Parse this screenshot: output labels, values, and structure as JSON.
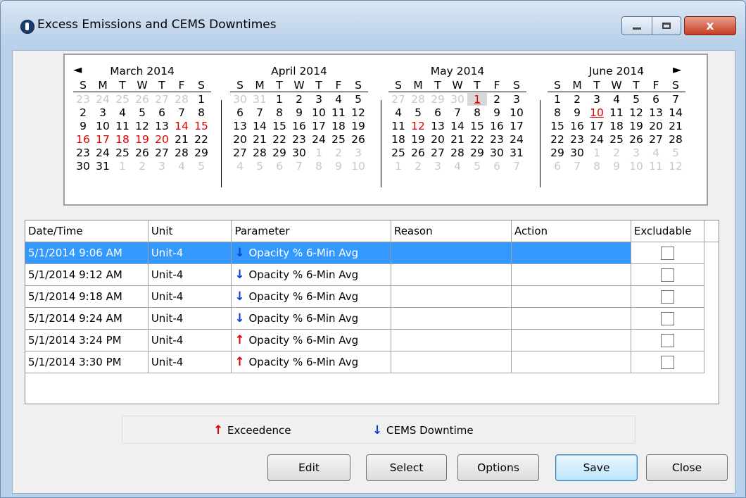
{
  "window": {
    "title": "Excess Emissions and CEMS Downtimes",
    "close_glyph": "x"
  },
  "calendar": {
    "nav_prev": "◄",
    "nav_next": "►",
    "weekday_headers": [
      "S",
      "M",
      "T",
      "W",
      "T",
      "F",
      "S"
    ],
    "months": [
      {
        "title": "March 2014",
        "days": [
          [
            "23",
            "",
            "fill"
          ],
          [
            "24",
            "",
            "fill"
          ],
          [
            "25",
            "",
            "fill"
          ],
          [
            "26",
            "",
            "fill"
          ],
          [
            "27",
            "",
            "fill"
          ],
          [
            "28",
            "",
            "fill"
          ],
          [
            "1",
            "",
            ""
          ],
          [
            "2",
            "",
            ""
          ],
          [
            "3",
            "",
            ""
          ],
          [
            "4",
            "",
            ""
          ],
          [
            "5",
            "",
            ""
          ],
          [
            "6",
            "",
            ""
          ],
          [
            "7",
            "",
            ""
          ],
          [
            "8",
            "",
            ""
          ],
          [
            "9",
            "",
            ""
          ],
          [
            "10",
            "",
            ""
          ],
          [
            "11",
            "",
            ""
          ],
          [
            "12",
            "",
            ""
          ],
          [
            "13",
            "",
            ""
          ],
          [
            "14",
            "",
            "red"
          ],
          [
            "15",
            "",
            "red"
          ],
          [
            "16",
            "",
            "red"
          ],
          [
            "17",
            "",
            "red"
          ],
          [
            "18",
            "",
            "red"
          ],
          [
            "19",
            "",
            "red"
          ],
          [
            "20",
            "",
            "red"
          ],
          [
            "21",
            "",
            ""
          ],
          [
            "22",
            "",
            ""
          ],
          [
            "23",
            "",
            ""
          ],
          [
            "24",
            "",
            ""
          ],
          [
            "25",
            "",
            ""
          ],
          [
            "26",
            "",
            ""
          ],
          [
            "27",
            "",
            ""
          ],
          [
            "28",
            "",
            ""
          ],
          [
            "29",
            "",
            ""
          ],
          [
            "30",
            "",
            ""
          ],
          [
            "31",
            "",
            ""
          ],
          [
            "1",
            "",
            "fill"
          ],
          [
            "2",
            "",
            "fill"
          ],
          [
            "3",
            "",
            "fill"
          ],
          [
            "4",
            "",
            "fill"
          ],
          [
            "5",
            "",
            "fill"
          ]
        ]
      },
      {
        "title": "April 2014",
        "days": [
          [
            "30",
            "",
            "fill"
          ],
          [
            "31",
            "",
            "fill"
          ],
          [
            "1",
            "",
            ""
          ],
          [
            "2",
            "",
            ""
          ],
          [
            "3",
            "",
            ""
          ],
          [
            "4",
            "",
            ""
          ],
          [
            "5",
            "",
            ""
          ],
          [
            "6",
            "",
            ""
          ],
          [
            "7",
            "",
            ""
          ],
          [
            "8",
            "",
            ""
          ],
          [
            "9",
            "",
            ""
          ],
          [
            "10",
            "",
            ""
          ],
          [
            "11",
            "",
            ""
          ],
          [
            "12",
            "",
            ""
          ],
          [
            "13",
            "",
            ""
          ],
          [
            "14",
            "",
            ""
          ],
          [
            "15",
            "",
            ""
          ],
          [
            "16",
            "",
            ""
          ],
          [
            "17",
            "",
            ""
          ],
          [
            "18",
            "",
            ""
          ],
          [
            "19",
            "",
            ""
          ],
          [
            "20",
            "",
            ""
          ],
          [
            "21",
            "",
            ""
          ],
          [
            "22",
            "",
            ""
          ],
          [
            "23",
            "",
            ""
          ],
          [
            "24",
            "",
            ""
          ],
          [
            "25",
            "",
            ""
          ],
          [
            "26",
            "",
            ""
          ],
          [
            "27",
            "",
            ""
          ],
          [
            "28",
            "",
            ""
          ],
          [
            "29",
            "",
            ""
          ],
          [
            "30",
            "",
            ""
          ],
          [
            "1",
            "",
            "fill"
          ],
          [
            "2",
            "",
            "fill"
          ],
          [
            "3",
            "",
            "fill"
          ],
          [
            "4",
            "",
            "fill"
          ],
          [
            "5",
            "",
            "fill"
          ],
          [
            "6",
            "",
            "fill"
          ],
          [
            "7",
            "",
            "fill"
          ],
          [
            "8",
            "",
            "fill"
          ],
          [
            "9",
            "",
            "fill"
          ],
          [
            "10",
            "",
            "fill"
          ]
        ]
      },
      {
        "title": "May 2014",
        "days": [
          [
            "27",
            "",
            "fill"
          ],
          [
            "28",
            "",
            "fill"
          ],
          [
            "29",
            "",
            "fill"
          ],
          [
            "30",
            "",
            "fill"
          ],
          [
            "1",
            "",
            "red today ul"
          ],
          [
            "2",
            "",
            ""
          ],
          [
            "3",
            "",
            ""
          ],
          [
            "4",
            "",
            ""
          ],
          [
            "5",
            "",
            ""
          ],
          [
            "6",
            "",
            ""
          ],
          [
            "7",
            "",
            ""
          ],
          [
            "8",
            "",
            ""
          ],
          [
            "9",
            "",
            ""
          ],
          [
            "10",
            "",
            ""
          ],
          [
            "11",
            "",
            ""
          ],
          [
            "12",
            "",
            "red"
          ],
          [
            "13",
            "",
            ""
          ],
          [
            "14",
            "",
            ""
          ],
          [
            "15",
            "",
            ""
          ],
          [
            "16",
            "",
            ""
          ],
          [
            "17",
            "",
            ""
          ],
          [
            "18",
            "",
            ""
          ],
          [
            "19",
            "",
            ""
          ],
          [
            "20",
            "",
            ""
          ],
          [
            "21",
            "",
            ""
          ],
          [
            "22",
            "",
            ""
          ],
          [
            "23",
            "",
            ""
          ],
          [
            "24",
            "",
            ""
          ],
          [
            "25",
            "",
            ""
          ],
          [
            "26",
            "",
            ""
          ],
          [
            "27",
            "",
            ""
          ],
          [
            "28",
            "",
            ""
          ],
          [
            "29",
            "",
            ""
          ],
          [
            "30",
            "",
            ""
          ],
          [
            "31",
            "",
            ""
          ],
          [
            "1",
            "",
            "fill"
          ],
          [
            "2",
            "",
            "fill"
          ],
          [
            "3",
            "",
            "fill"
          ],
          [
            "4",
            "",
            "fill"
          ],
          [
            "5",
            "",
            "fill"
          ],
          [
            "6",
            "",
            "fill"
          ],
          [
            "7",
            "",
            "fill"
          ]
        ]
      },
      {
        "title": "June 2014",
        "days": [
          [
            "1",
            "",
            ""
          ],
          [
            "2",
            "",
            ""
          ],
          [
            "3",
            "",
            ""
          ],
          [
            "4",
            "",
            ""
          ],
          [
            "5",
            "",
            ""
          ],
          [
            "6",
            "",
            ""
          ],
          [
            "7",
            "",
            ""
          ],
          [
            "8",
            "",
            ""
          ],
          [
            "9",
            "",
            ""
          ],
          [
            "10",
            "",
            "red ul"
          ],
          [
            "11",
            "",
            ""
          ],
          [
            "12",
            "",
            ""
          ],
          [
            "13",
            "",
            ""
          ],
          [
            "14",
            "",
            ""
          ],
          [
            "15",
            "",
            ""
          ],
          [
            "16",
            "",
            ""
          ],
          [
            "17",
            "",
            ""
          ],
          [
            "18",
            "",
            ""
          ],
          [
            "19",
            "",
            ""
          ],
          [
            "20",
            "",
            ""
          ],
          [
            "21",
            "",
            ""
          ],
          [
            "22",
            "",
            ""
          ],
          [
            "23",
            "",
            ""
          ],
          [
            "24",
            "",
            ""
          ],
          [
            "25",
            "",
            ""
          ],
          [
            "26",
            "",
            ""
          ],
          [
            "27",
            "",
            ""
          ],
          [
            "28",
            "",
            ""
          ],
          [
            "29",
            "",
            ""
          ],
          [
            "30",
            "",
            ""
          ],
          [
            "1",
            "",
            "fill"
          ],
          [
            "2",
            "",
            "fill"
          ],
          [
            "3",
            "",
            "fill"
          ],
          [
            "4",
            "",
            "fill"
          ],
          [
            "5",
            "",
            "fill"
          ],
          [
            "6",
            "",
            "fill"
          ],
          [
            "7",
            "",
            "fill"
          ],
          [
            "8",
            "",
            "fill"
          ],
          [
            "9",
            "",
            "fill"
          ],
          [
            "10",
            "",
            "fill"
          ],
          [
            "11",
            "",
            "fill"
          ],
          [
            "12",
            "",
            "fill"
          ]
        ]
      }
    ]
  },
  "table": {
    "columns": [
      "Date/Time",
      "Unit",
      "Parameter",
      "Reason",
      "Action",
      "Excludable"
    ],
    "rows": [
      {
        "datetime": "5/1/2014 9:06 AM",
        "unit": "Unit-4",
        "direction": "down",
        "arrow": "↓",
        "parameter": "Opacity % 6-Min Avg",
        "reason": "",
        "action": "",
        "excludable": false,
        "selected": true
      },
      {
        "datetime": "5/1/2014 9:12 AM",
        "unit": "Unit-4",
        "direction": "down",
        "arrow": "↓",
        "parameter": "Opacity % 6-Min Avg",
        "reason": "",
        "action": "",
        "excludable": false,
        "selected": false
      },
      {
        "datetime": "5/1/2014 9:18 AM",
        "unit": "Unit-4",
        "direction": "down",
        "arrow": "↓",
        "parameter": "Opacity % 6-Min Avg",
        "reason": "",
        "action": "",
        "excludable": false,
        "selected": false
      },
      {
        "datetime": "5/1/2014 9:24 AM",
        "unit": "Unit-4",
        "direction": "down",
        "arrow": "↓",
        "parameter": "Opacity % 6-Min Avg",
        "reason": "",
        "action": "",
        "excludable": false,
        "selected": false
      },
      {
        "datetime": "5/1/2014 3:24 PM",
        "unit": "Unit-4",
        "direction": "up",
        "arrow": "↑",
        "parameter": "Opacity % 6-Min Avg",
        "reason": "",
        "action": "",
        "excludable": false,
        "selected": false
      },
      {
        "datetime": "5/1/2014 3:30 PM",
        "unit": "Unit-4",
        "direction": "up",
        "arrow": "↑",
        "parameter": "Opacity % 6-Min Avg",
        "reason": "",
        "action": "",
        "excludable": false,
        "selected": false
      }
    ]
  },
  "legend": {
    "exceedence_arrow": "↑",
    "exceedence_label": "Exceedence",
    "downtime_arrow": "↓",
    "downtime_label": "CEMS Downtime"
  },
  "buttons": {
    "edit": "Edit",
    "select": "Select",
    "options": "Options",
    "save": "Save",
    "close": "Close"
  },
  "colors": {
    "selection": "#3399ff",
    "exceedence": "#e00000",
    "downtime": "#0a3ad8",
    "highlight_day": "#e00000"
  }
}
